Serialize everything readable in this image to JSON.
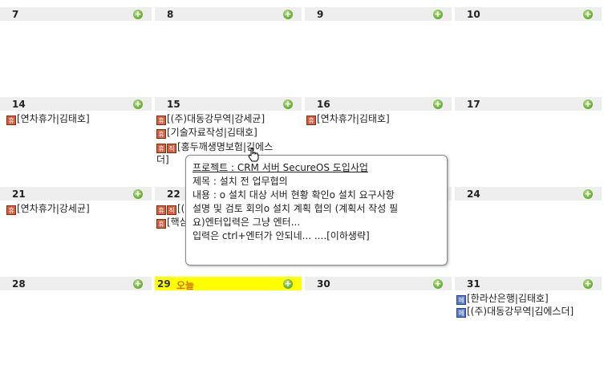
{
  "rows": [
    {
      "cells": [
        {
          "day": "7"
        },
        {
          "day": "8"
        },
        {
          "day": "9"
        },
        {
          "day": "10"
        }
      ]
    },
    {
      "cells": [
        {
          "day": "14"
        },
        {
          "day": "15"
        },
        {
          "day": "16"
        },
        {
          "day": "17"
        }
      ]
    },
    {
      "cells": [
        {
          "day": "21"
        },
        {
          "day": "22"
        },
        {
          "day": "23"
        },
        {
          "day": "24"
        }
      ]
    },
    {
      "cells": [
        {
          "day": "28"
        },
        {
          "day": "29",
          "today_label": "오늘"
        },
        {
          "day": "30"
        },
        {
          "day": "31"
        }
      ]
    }
  ],
  "add_glyph": "+",
  "events": {
    "d14": [
      {
        "icon": "휴",
        "text": "[연차휴가|김태호]"
      }
    ],
    "d15": [
      {
        "icon": "휴",
        "text": "[(주)대동강무역|강세균]"
      },
      {
        "icon": "휴",
        "text": "[기술자료작성|김태호]"
      },
      {
        "icon": "휴",
        "icon2": "직",
        "text": "[홍두깨생명보험|김에스",
        "text_cont": "더]"
      }
    ],
    "d16": [
      {
        "icon": "휴",
        "text": "[연차휴가|김태호]"
      }
    ],
    "d21": [
      {
        "icon": "휴",
        "text": "[연차휴가|강세균]"
      }
    ],
    "d22": [
      {
        "icon": "휴",
        "icon2": "직",
        "text": "[("
      },
      {
        "icon": "휴",
        "text": "[핵심"
      }
    ],
    "d31": [
      {
        "icon": "메",
        "text": "[한라산은행|김태호]"
      },
      {
        "icon": "메",
        "text": "[(주)대동강무역|김에스더]"
      }
    ]
  },
  "tooltip": {
    "project": "프로젝트 : CRM 서버 SecureOS 도입사업",
    "title": "제목 : 설치 전 업무협의",
    "content_1": "내용 : o 설치 대상 서버 현황 확인o 설치 요구사항",
    "content_2": "설명 및 검토 회의o 설치 계획 협의 (계획서 작성 필",
    "content_3": "요)엔터입력은 그냥 엔터...",
    "content_4": "입력은 ctrl+엔터가 안되네... ....[이하생략]"
  },
  "colors": {
    "header": "#eeeeee",
    "today": "#ffff00",
    "add": "#6fb13a"
  }
}
